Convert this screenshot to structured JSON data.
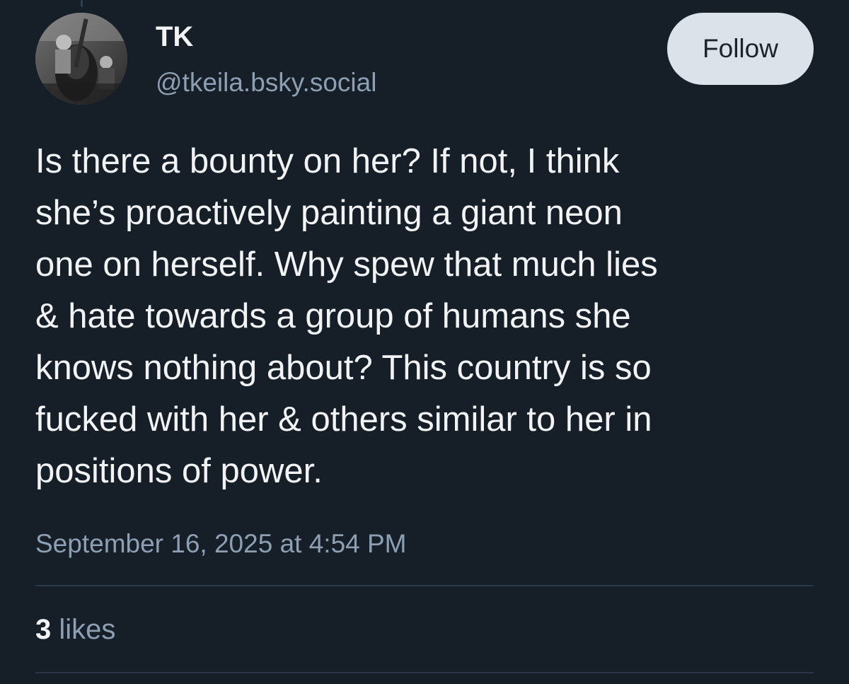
{
  "author": {
    "display_name": "TK",
    "handle": "@tkeila.bsky.social",
    "avatar": "avatar-photo-upright-bass-player"
  },
  "follow_label": "Follow",
  "post": {
    "text": "Is there a bounty on her? If not, I think\nshe’s proactively painting a giant neon\none on herself. Why spew that much lies\n& hate towards a group of humans she\nknows nothing about? This country is so\nfucked with her & others similar to her in\npositions of power.",
    "timestamp": "September 16, 2025 at 4:54 PM"
  },
  "stats": {
    "likes_count": "3",
    "likes_label": "likes"
  },
  "colors": {
    "background": "#161e27",
    "text": "#f1f3f5",
    "muted": "#8d9fb3",
    "follow_bg": "#dce2ea"
  }
}
